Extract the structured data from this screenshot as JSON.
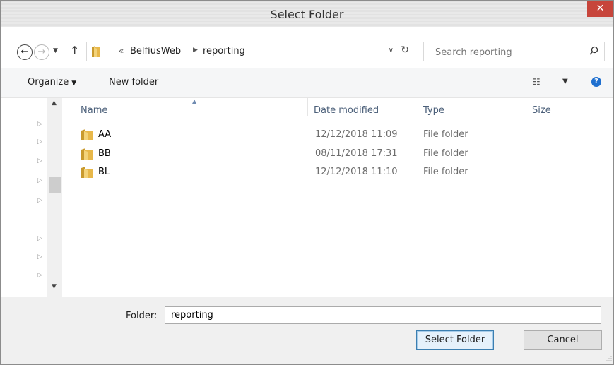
{
  "window": {
    "title": "Select Folder",
    "close_glyph": "✕"
  },
  "address": {
    "back_glyph": "←",
    "forward_glyph": "→",
    "recent_glyph": "▼",
    "up_glyph": "↑",
    "overflow_glyph": "«",
    "breadcrumb": [
      "BelfiusWeb",
      "reporting"
    ],
    "separator_glyph": "▶",
    "dropdown_glyph": "∨",
    "refresh_glyph": "↻",
    "search_placeholder": "Search reporting"
  },
  "toolbar": {
    "organize_label": "Organize",
    "organize_caret": "▼",
    "new_folder_label": "New folder",
    "views_glyph": "☷",
    "views_caret": "▼",
    "help_glyph": "?"
  },
  "navpane": {
    "arrow_glyph": "▷",
    "scroll_up_glyph": "▲",
    "scroll_down_glyph": "▼"
  },
  "columns": {
    "name": "Name",
    "date_modified": "Date modified",
    "type": "Type",
    "size": "Size",
    "sort_glyph": "▲"
  },
  "files": [
    {
      "name": "AA",
      "date": "12/12/2018 11:09",
      "type": "File folder"
    },
    {
      "name": "BB",
      "date": "08/11/2018 17:31",
      "type": "File folder"
    },
    {
      "name": "BL",
      "date": "12/12/2018 11:10",
      "type": "File folder"
    }
  ],
  "footer": {
    "folder_label": "Folder:",
    "folder_value": "reporting",
    "select_button": "Select Folder",
    "cancel_button": "Cancel"
  },
  "colors": {
    "close_red": "#c7453b",
    "folder_yellow": "#e8b84a",
    "header_blue": "#4c607a",
    "help_blue": "#1e6fcf"
  }
}
